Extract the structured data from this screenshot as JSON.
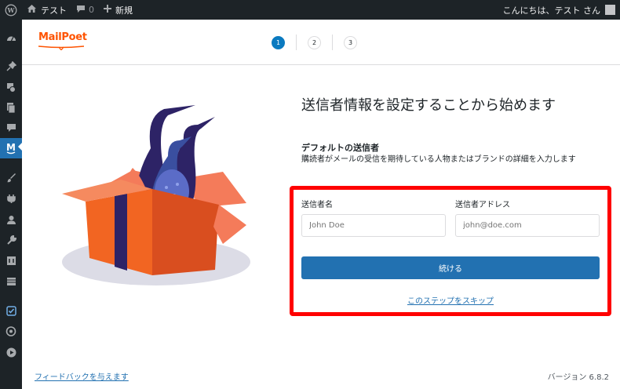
{
  "adminbar": {
    "site_name": "テスト",
    "comments_count": "0",
    "new_label": "新規",
    "greeting": "こんにちは、テスト さん"
  },
  "sidebar": {
    "items": [
      {
        "icon": "dashboard-icon"
      },
      {
        "icon": "pin-icon"
      },
      {
        "icon": "media-icon"
      },
      {
        "icon": "pages-icon"
      },
      {
        "icon": "comments-icon"
      },
      {
        "icon": "mailpoet-icon",
        "active": true
      },
      {
        "icon": "appearance-icon"
      },
      {
        "icon": "plugins-icon"
      },
      {
        "icon": "users-icon"
      },
      {
        "icon": "tools-icon"
      },
      {
        "icon": "settings-icon"
      },
      {
        "icon": "table-icon"
      },
      {
        "icon": "check-icon"
      },
      {
        "icon": "eye-icon"
      },
      {
        "icon": "play-icon"
      }
    ]
  },
  "header": {
    "logo": "MailPoet",
    "steps": [
      "1",
      "2",
      "3"
    ]
  },
  "form": {
    "title": "送信者情報を設定することから始めます",
    "section_title": "デフォルトの送信者",
    "section_desc": "購読者がメールの受信を期待している人物またはブランドの詳細を入力します",
    "sender_name_label": "送信者名",
    "sender_name_placeholder": "John Doe",
    "sender_address_label": "送信者アドレス",
    "sender_address_placeholder": "john@doe.com",
    "continue_label": "続ける",
    "skip_label": "このステップをスキップ"
  },
  "footer": {
    "feedback_label": "フィードバックを与えます",
    "version": "バージョン 6.8.2"
  },
  "colors": {
    "accent": "#2271b1",
    "brand": "#fe5301",
    "highlight": "#ff0000",
    "adminbar": "#1d2327"
  }
}
